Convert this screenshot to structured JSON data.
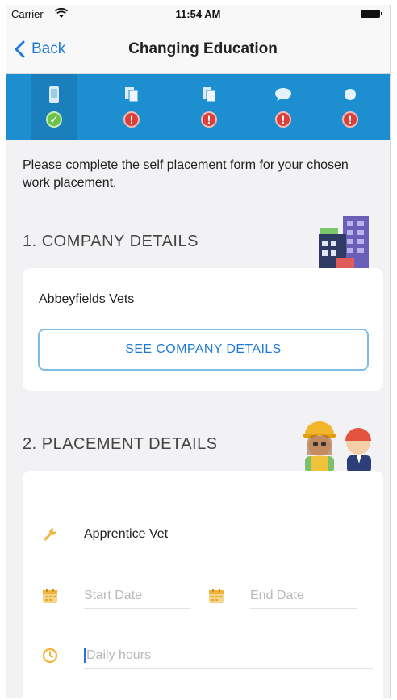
{
  "status_bar": {
    "carrier": "Carrier",
    "time": "11:54 AM"
  },
  "nav": {
    "back_label": "Back",
    "title": "Changing Education"
  },
  "steps": [
    {
      "icon": "phone-icon",
      "status": "complete",
      "active": true
    },
    {
      "icon": "documents-icon",
      "status": "error",
      "active": false
    },
    {
      "icon": "documents-icon",
      "status": "error",
      "active": false
    },
    {
      "icon": "chat-bubble-icon",
      "status": "error",
      "active": false
    },
    {
      "icon": "dot-icon",
      "status": "error",
      "active": false
    }
  ],
  "intro": "Please complete the self placement form for your chosen work placement.",
  "company_section": {
    "heading": "1. COMPANY DETAILS",
    "company_name": "Abbeyfields Vets",
    "button_label": "SEE COMPANY DETAILS"
  },
  "placement_section": {
    "heading": "2. PLACEMENT DETAILS",
    "job_title_value": "Apprentice Vet",
    "start_date_placeholder": "Start Date",
    "end_date_placeholder": "End Date",
    "daily_hours_placeholder": "Daily hours"
  },
  "colors": {
    "accent_blue": "#1d8fd1",
    "link_blue": "#1e7ad6",
    "success_green": "#6cc24a",
    "error_red": "#d9403a",
    "form_icon_yellow": "#f0b43c"
  }
}
